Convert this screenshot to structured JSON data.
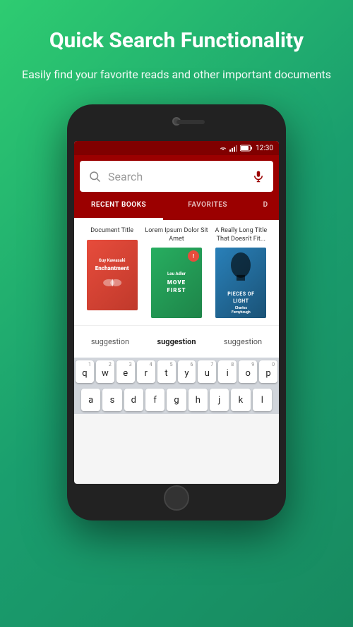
{
  "page": {
    "background_from": "#2ecc71",
    "background_to": "#178a60"
  },
  "header": {
    "title": "Quick Search Functionality",
    "subtitle": "Easily find your favorite reads and other important documents"
  },
  "status_bar": {
    "time": "12:30"
  },
  "search": {
    "placeholder": "Search",
    "search_icon": "🔍",
    "mic_icon": "🎤"
  },
  "tabs": [
    {
      "label": "RECENT BOOKS",
      "active": true
    },
    {
      "label": "FAVORITES",
      "active": false
    },
    {
      "label": "D",
      "active": false,
      "partial": true
    }
  ],
  "books": [
    {
      "title": "Document Title",
      "cover_author": "Guy Kawasaki",
      "cover_book": "Enchantment",
      "cover_color": "red"
    },
    {
      "title": "Lorem Ipsum Dolor Sit Amet",
      "cover_author": "Lou Adler",
      "cover_book": "MOVE FIRST",
      "cover_color": "green",
      "badge": "!"
    },
    {
      "title": "A Really Long Title That Doesn't Fit...",
      "cover_author": "Charles Fernyhough",
      "cover_book": "PIECES OF LIGHT",
      "cover_color": "blue"
    }
  ],
  "suggestions": [
    {
      "label": "suggestion",
      "bold": false
    },
    {
      "label": "suggestion",
      "bold": true
    },
    {
      "label": "suggestion",
      "bold": false
    }
  ],
  "keyboard": {
    "rows": [
      {
        "keys": [
          {
            "letter": "q",
            "number": "1"
          },
          {
            "letter": "w",
            "number": "2"
          },
          {
            "letter": "e",
            "number": "3"
          },
          {
            "letter": "r",
            "number": "4"
          },
          {
            "letter": "t",
            "number": "5"
          },
          {
            "letter": "y",
            "number": "6"
          },
          {
            "letter": "u",
            "number": "7"
          },
          {
            "letter": "i",
            "number": "8"
          },
          {
            "letter": "o",
            "number": "9"
          },
          {
            "letter": "p",
            "number": "0"
          }
        ]
      },
      {
        "keys": [
          {
            "letter": "a"
          },
          {
            "letter": "s"
          },
          {
            "letter": "d"
          },
          {
            "letter": "f"
          },
          {
            "letter": "g"
          },
          {
            "letter": "h"
          },
          {
            "letter": "j"
          },
          {
            "letter": "k"
          },
          {
            "letter": "l"
          }
        ]
      }
    ]
  }
}
